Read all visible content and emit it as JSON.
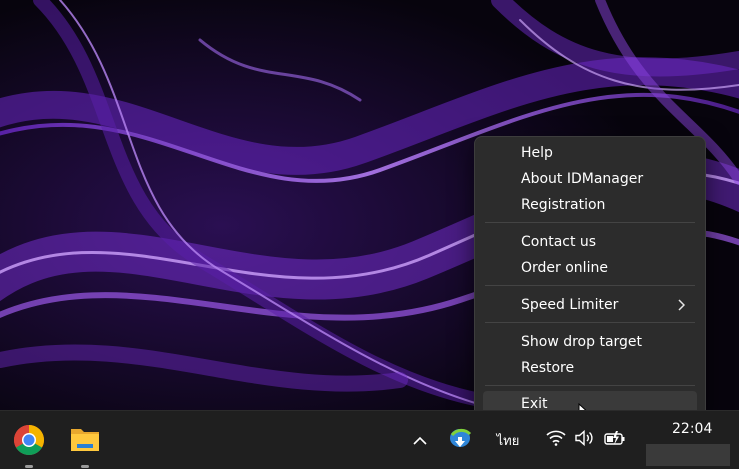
{
  "context_menu": {
    "items": [
      {
        "label": "Help"
      },
      {
        "label": "About IDManager"
      },
      {
        "label": "Registration"
      },
      {
        "label": "Contact us"
      },
      {
        "label": "Order online"
      },
      {
        "label": "Speed Limiter",
        "has_submenu": true
      },
      {
        "label": "Show drop target"
      },
      {
        "label": "Restore"
      },
      {
        "label": "Exit",
        "hovered": true
      }
    ]
  },
  "taskbar": {
    "apps": [
      {
        "icon": "chrome-icon"
      },
      {
        "icon": "file-explorer-icon"
      }
    ],
    "tray": {
      "show_hidden_icon": "chevron-up-icon",
      "app_icon": "idm-tray-icon",
      "language": "ไทย",
      "wifi_icon": "wifi-icon",
      "volume_icon": "volume-icon",
      "battery_icon": "battery-charging-icon"
    },
    "clock": {
      "time": "22:04",
      "date": ""
    }
  },
  "colors": {
    "menu_bg": "#2c2c2c",
    "menu_hover": "#3a3a3a",
    "taskbar_bg": "#1f1f1f",
    "wallpaper_accent": "#8a3bdb"
  }
}
